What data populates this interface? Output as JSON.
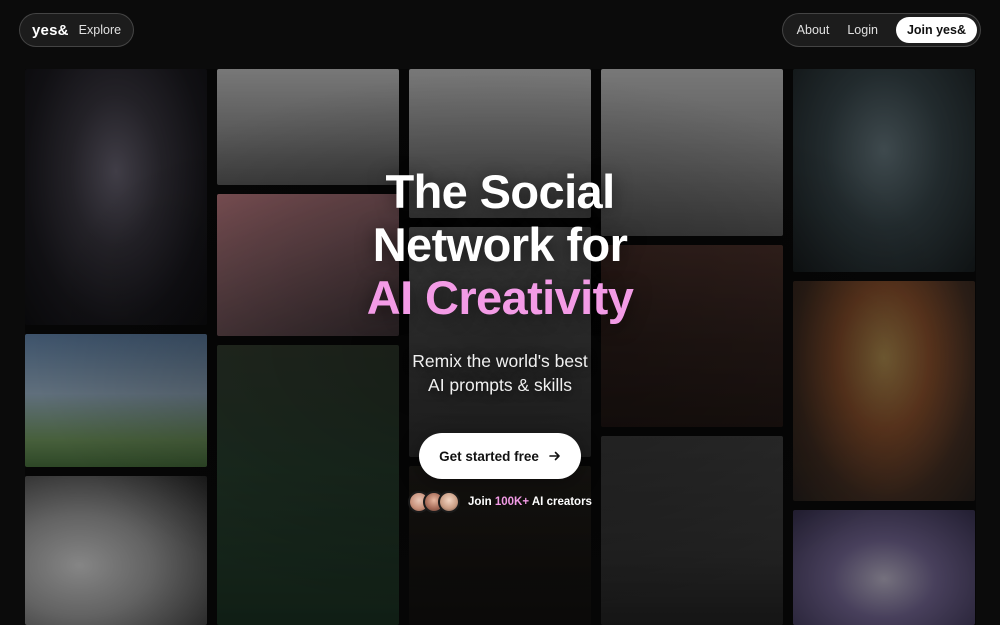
{
  "nav": {
    "logo": "yes&",
    "explore": "Explore",
    "about": "About",
    "login": "Login",
    "join": "Join yes&"
  },
  "hero": {
    "line1": "The Social",
    "line2": "Network for",
    "line3": "AI Creativity",
    "sub1": "Remix the world's best",
    "sub2": "AI prompts & skills",
    "cta": "Get started free",
    "cta_icon": "arrow-right-icon",
    "proof_prefix": "Join",
    "proof_count": "100K+",
    "proof_suffix": "AI creators"
  },
  "colors": {
    "accent": "#f39be6",
    "background": "#0b0b0b",
    "button_bg": "#ffffff"
  }
}
